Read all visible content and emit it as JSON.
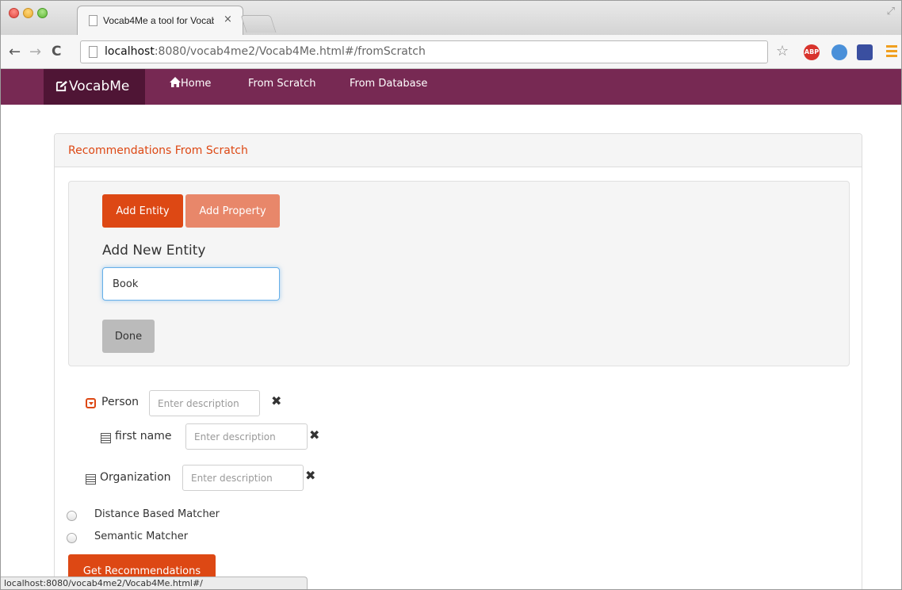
{
  "browser": {
    "tab_title": "Vocab4Me a tool for Vocab",
    "tab_close": "×",
    "url_host": "localhost",
    "url_rest": ":8080/vocab4me2/Vocab4Me.html#/fromScratch",
    "back_glyph": "←",
    "forward_glyph": "→",
    "reload_glyph": "C",
    "star_glyph": "☆",
    "ext_abp": "ABP",
    "status_url": "localhost:8080/vocab4me2/Vocab4Me.html#/"
  },
  "navbar": {
    "brand": "VocabMe",
    "brand_icon": "edit-icon",
    "home": "Home",
    "home_icon": "home-icon",
    "from_scratch": "From Scratch",
    "from_database": "From Database",
    "color": "#772953",
    "brand_color": "#4f1535"
  },
  "panel": {
    "heading": "Recommendations From Scratch",
    "add_entity": "Add Entity",
    "add_property": "Add Property",
    "add_new_title": "Add New Entity",
    "entity_value": "Book",
    "done": "Done",
    "accent": "#dd4814"
  },
  "tree": [
    {
      "label": "Person",
      "icon": "caret-down-icon",
      "placeholder": "Enter description"
    },
    {
      "label": "first name",
      "icon": "list-icon",
      "placeholder": "Enter description"
    },
    {
      "label": "Organization",
      "icon": "list-icon",
      "placeholder": "Enter description"
    }
  ],
  "remove_glyph": "✖",
  "matchers": [
    {
      "label": "Distance Based Matcher",
      "selected": false
    },
    {
      "label": "Semantic Matcher",
      "selected": false
    }
  ],
  "get_recommendations": "Get Recommendations"
}
